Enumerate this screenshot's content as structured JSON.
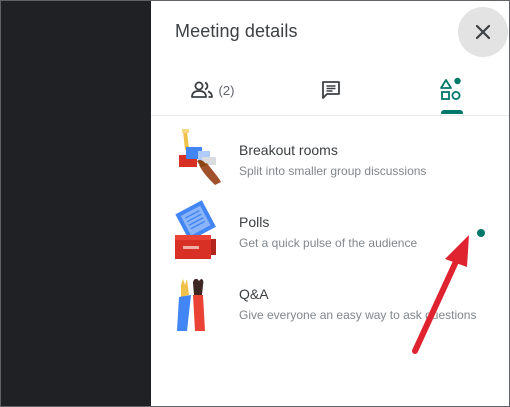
{
  "panel": {
    "title": "Meeting details"
  },
  "tabs": {
    "people_count": "(2)"
  },
  "activities": [
    {
      "title": "Breakout rooms",
      "subtitle": "Split into smaller group discussions"
    },
    {
      "title": "Polls",
      "subtitle": "Get a quick pulse of the audience"
    },
    {
      "title": "Q&A",
      "subtitle": "Give everyone an easy way to ask questions"
    }
  ],
  "icons": {
    "close": "close-icon",
    "people": "people-icon",
    "chat": "chat-icon",
    "activities": "activities-icon"
  },
  "colors": {
    "accent": "#00796b",
    "annotation_arrow": "#e0242f",
    "close_bg": "#e3e3e3",
    "dark_bg": "#202124"
  }
}
